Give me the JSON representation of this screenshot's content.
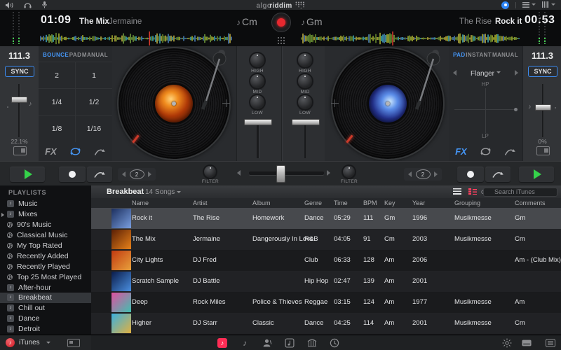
{
  "colors": {
    "accent_blue": "#4596f7",
    "accent_pink": "#ff2d55",
    "play_green": "#35d24a",
    "record_red": "#e8282f",
    "waveform_palette": [
      "#8bc34a",
      "#cddc39",
      "#4dd0e1",
      "#5c9ce6",
      "#e8d44d",
      "#7ea832"
    ]
  },
  "menubar": {
    "logo_gray": "algo",
    "logo_bold": "riddim"
  },
  "deck_a": {
    "elapsed": "01:09",
    "title": "The Mix",
    "artist": "Jermaine",
    "key": "Cm",
    "bpm": "111.3",
    "sync_label": "SYNC",
    "pitch_pct": "22.1%",
    "tabs": [
      "BOUNCE",
      "PAD",
      "MANUAL"
    ],
    "active_tab": "BOUNCE",
    "pads": [
      "2",
      "1",
      "1/4",
      "1/2",
      "1/8",
      "1/16"
    ],
    "fx_label": "FX",
    "loop_count": "2",
    "filter_label": "FILTER",
    "playhead_frac": 0.57
  },
  "deck_b": {
    "remaining": "00:53",
    "title": "Rock it",
    "artist": "The Rise",
    "key": "Gm",
    "bpm": "111.3",
    "sync_label": "SYNC",
    "pitch_pct": "0%",
    "tabs": [
      "PAD",
      "INSTANT",
      "MANUAL"
    ],
    "active_tab": "PAD",
    "fx_selected": "Flanger",
    "pad_top": "HP",
    "pad_bottom": "LP",
    "fx_label": "FX",
    "loop_count": "2",
    "filter_label": "FILTER",
    "playhead_frac": 0.42
  },
  "mixer": {
    "eq_labels": [
      "HIGH",
      "MID",
      "LOW"
    ]
  },
  "library": {
    "sidebar": {
      "header": "PLAYLISTS",
      "items": [
        {
          "label": "Music",
          "icon": "note"
        },
        {
          "label": "Mixes",
          "icon": "note",
          "disclosure": true
        },
        {
          "label": "90's Music",
          "icon": "smart"
        },
        {
          "label": "Classical Music",
          "icon": "smart"
        },
        {
          "label": "My Top Rated",
          "icon": "smart"
        },
        {
          "label": "Recently Added",
          "icon": "smart"
        },
        {
          "label": "Recently Played",
          "icon": "smart"
        },
        {
          "label": "Top 25 Most Played",
          "icon": "smart"
        },
        {
          "label": "After-hour",
          "icon": "note"
        },
        {
          "label": "Breakbeat",
          "icon": "note",
          "selected": true
        },
        {
          "label": "Chill out",
          "icon": "note"
        },
        {
          "label": "Dance",
          "icon": "note"
        },
        {
          "label": "Detroit",
          "icon": "note"
        },
        {
          "label": "",
          "icon": "note"
        }
      ],
      "source": "iTunes"
    },
    "toolbar": {
      "title": "Breakbeat",
      "count": "14 Songs",
      "search_placeholder": "Search iTunes"
    },
    "columns": [
      {
        "label": "Name"
      },
      {
        "label": "Artist"
      },
      {
        "label": "Album"
      },
      {
        "label": "Genre"
      },
      {
        "label": "Time"
      },
      {
        "label": "BPM"
      },
      {
        "label": "Key"
      },
      {
        "label": "Year"
      },
      {
        "label": "Grouping"
      },
      {
        "label": "Comments"
      }
    ],
    "rows": [
      {
        "name": "Rock it",
        "artist": "The Rise",
        "album": "Homework",
        "genre": "Dance",
        "time": "05:29",
        "bpm": "111",
        "key": "Gm",
        "year": "1996",
        "grouping": "Musikmesse",
        "comments": "Gm",
        "selected": true,
        "art": [
          "#1c2f5e",
          "#7a9fe0"
        ]
      },
      {
        "name": "The Mix",
        "artist": "Jermaine",
        "album": "Dangerously In Love",
        "genre": "R&B",
        "time": "04:05",
        "bpm": "91",
        "key": "Cm",
        "year": "2003",
        "grouping": "Musikmesse",
        "comments": "Cm",
        "art": [
          "#5a1f05",
          "#e8821a"
        ]
      },
      {
        "name": "City Lights",
        "artist": "DJ Fred",
        "album": "",
        "genre": "Club",
        "time": "06:33",
        "bpm": "128",
        "key": "Am",
        "year": "2006",
        "grouping": "",
        "comments": "Am - (Club Mix)",
        "art": [
          "#c23a10",
          "#e8a13c"
        ]
      },
      {
        "name": "Scratch Sample",
        "artist": "DJ Battle",
        "album": "",
        "genre": "Hip Hop",
        "time": "02:47",
        "bpm": "139",
        "key": "Am",
        "year": "2001",
        "grouping": "",
        "comments": "",
        "art": [
          "#0a1c4a",
          "#4a8fe0"
        ]
      },
      {
        "name": "Deep",
        "artist": "Rock Miles",
        "album": "Police & Thieves",
        "genre": "Reggae",
        "time": "03:15",
        "bpm": "124",
        "key": "Am",
        "year": "1977",
        "grouping": "Musikmesse",
        "comments": "Am",
        "art": [
          "#e050a0",
          "#40c0b0"
        ]
      },
      {
        "name": "Higher",
        "artist": "DJ Starr",
        "album": "Classic",
        "genre": "Dance",
        "time": "04:25",
        "bpm": "114",
        "key": "Am",
        "year": "2001",
        "grouping": "Musikmesse",
        "comments": "Cm",
        "art": [
          "#3ab0e0",
          "#e0b040"
        ]
      },
      {
        "name": "",
        "artist": "",
        "album": "",
        "genre": "",
        "time": "",
        "bpm": "",
        "key": "",
        "year": "",
        "grouping": "",
        "comments": "",
        "art": [
          "#4a9a50",
          "#9fe08a"
        ]
      }
    ]
  }
}
